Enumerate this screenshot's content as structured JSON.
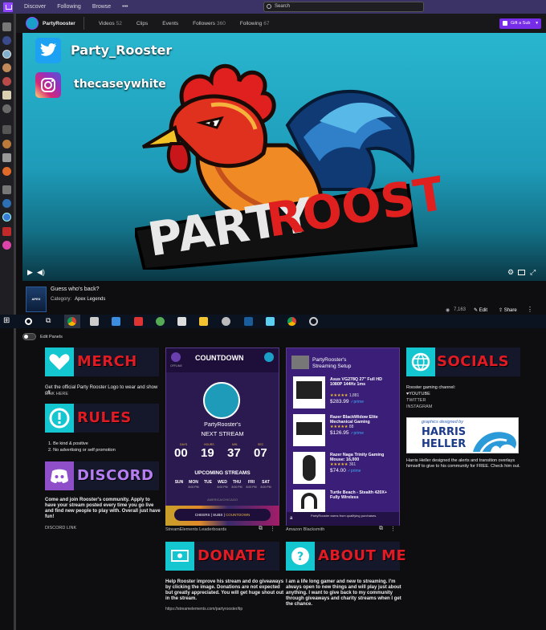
{
  "nav": {
    "discover": "Discover",
    "following": "Following",
    "browse": "Browse",
    "more": "•••"
  },
  "search": {
    "placeholder": "Search"
  },
  "channel": {
    "name": "PartyRooster",
    "tabs": [
      {
        "label": "Videos",
        "count": "52"
      },
      {
        "label": "Clips",
        "count": ""
      },
      {
        "label": "Events",
        "count": ""
      },
      {
        "label": "Followers",
        "count": "360"
      },
      {
        "label": "Following",
        "count": "67"
      }
    ],
    "gift_button": "Gift a Sub"
  },
  "video": {
    "twitter_handle": "Party_Rooster",
    "instagram_handle": "thecaseywhite",
    "logo_word_1": "PARTY",
    "logo_word_2": "ROOSTER"
  },
  "info": {
    "title": "Guess who's back?",
    "category_label": "Category:",
    "category_value": "Apex Legends",
    "game_art_text": "APEX",
    "views": "7,163",
    "edit": "Edit",
    "share": "Share"
  },
  "edit_panels_label": "Edit Panels",
  "panels": {
    "merch": {
      "title": "MERCH",
      "text": "Get the official Party Rooster Logo to wear and show off.",
      "link": "LINK HERE"
    },
    "rules": {
      "title": "RULES",
      "line1": "1. Be kind & positive",
      "line2": "2. No advertising or self promotion"
    },
    "discord": {
      "title": "DISCORD",
      "text": "Come and join Rooster's community. Apply to have your stream posted every time you go live and find new people to play with. Overall just have fun!",
      "link": "DISCORD LINK"
    },
    "countdown": {
      "header": "COUNTDOWN",
      "status": "OFFLINE",
      "channel": "PartyRooster's",
      "next": "NEXT STREAM",
      "days_label": "DAYS",
      "days": "00",
      "hours_label": "HOURS",
      "hours": "19",
      "min_label": "MIN",
      "min": "37",
      "sec_label": "SEC",
      "sec": "07",
      "upcoming": "UPCOMING STREAMS",
      "weekdays": [
        "SUN",
        "MON",
        "TUE",
        "WED",
        "THU",
        "FRI",
        "SAT"
      ],
      "times": [
        "",
        "8:00 PM",
        "",
        "8:00 PM",
        "8:00 PM",
        "8:00 PM",
        "8:00 PM"
      ],
      "timezone": "AMERICA/CHICAGO",
      "tabs": {
        "cheers": "CHEERS",
        "subs": "SUBS",
        "countdown": "COUNTDOWN"
      },
      "footer": "StreamElements Leaderboards"
    },
    "amazon": {
      "header_line1": "PartyRooster's",
      "header_line2": "Streaming Setup",
      "items": [
        {
          "name": "Asus VG278Q 27\" Full HD 1080P 144Hz 1ms",
          "rating": "1,881",
          "price": "$283.99"
        },
        {
          "name": "Razer BlackWidow Elite Mechanical Gaming",
          "rating": "88",
          "price": "$126.95"
        },
        {
          "name": "Razer Naga Trinity Gaming Mouse: 16,000",
          "rating": "361",
          "price": "$74.00"
        },
        {
          "name": "Turtle Beach - Stealth 420X+ Fully Wireless",
          "rating": "",
          "price": ""
        }
      ],
      "prime": "✓prime",
      "stars": "★★★★★",
      "footer_note": "PartyRooster earns from qualifying purchases.",
      "footer": "Amazon Blacksmith"
    },
    "socials": {
      "title": "SOCIALS",
      "text": "Rooster gaming channel:",
      "youtube": "YOUTUBE",
      "twitter": "TWITTER",
      "instagram": "INSTAGRAM",
      "designed_by": "graphics designed by",
      "designer_1": "HARRIS",
      "designer_2": "HELLER",
      "credit": "Harris Heller designed the alerts and transition overlays himself to give to his community for FREE. Check him out."
    },
    "donate": {
      "title": "DONATE",
      "text": "Help Rooster improve his stream and do giveaways by clicking the image. Donations are not expected but greatly appreciated. You will get huge shout out in the stream.",
      "link": "https://streamelements.com/partyrooster/tip"
    },
    "about": {
      "title": "ABOUT ME",
      "text": "I am a life long gamer and new to streaming. I'm always open to new things and will play just about anything. I want to give back to my community through giveaways and charity streams when I get the chance."
    }
  },
  "colors": {
    "twitch_purple": "#9147ff",
    "panel_red": "#e01b24",
    "panel_teal": "#14c6cf",
    "panel_violet": "#8e4fc9"
  }
}
